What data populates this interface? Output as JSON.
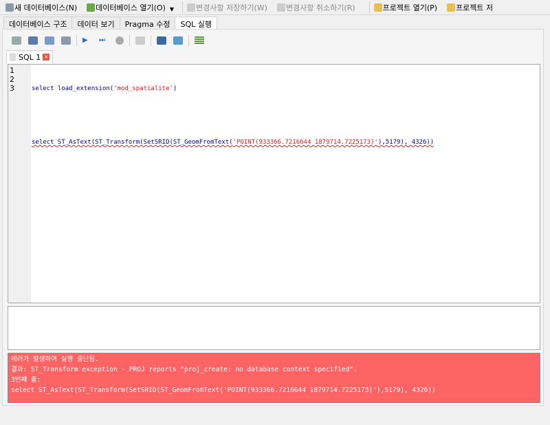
{
  "main_toolbar": {
    "new_db": "새 데이터베이스(N)",
    "open_db": "데이터베이스 열기(O)",
    "write_changes": "변경사항 저장하기(W)",
    "revert_changes": "변경사항 취소하기(R)",
    "open_project": "프로젝트 열기(P)",
    "save_project": "프로젝트 저"
  },
  "tabs": [
    "데이터베이스 구조",
    "데이터 보기",
    "Pragma 수정",
    "SQL 실행"
  ],
  "sql_tab": {
    "label": "SQL 1"
  },
  "editor": {
    "line_numbers": [
      "1",
      "2",
      "3"
    ],
    "line1": {
      "kw": "select load_extension(",
      "str": "'mod_spatialite'",
      "end": ")"
    },
    "line3": {
      "kw": "select ST_AsText(ST_Transform(SetSRID(ST_GeomFromText(",
      "str": "'POINT(933366.7216644 1879714.7225173)'",
      "end": "),5179), 4326))"
    }
  },
  "error": {
    "line1": "에러가 발생하여 실행 중단됨.",
    "line2": "결과: ST_Transform exception - PROJ reports \"proj_create: no database context specified\".",
    "line3": "3번째 줄:",
    "line4": "select ST_AsText(ST_Transform(SetSRID(ST_GeomFromText('POINT(933366.7216644 1879714.7225173)'),5179), 4326))"
  }
}
